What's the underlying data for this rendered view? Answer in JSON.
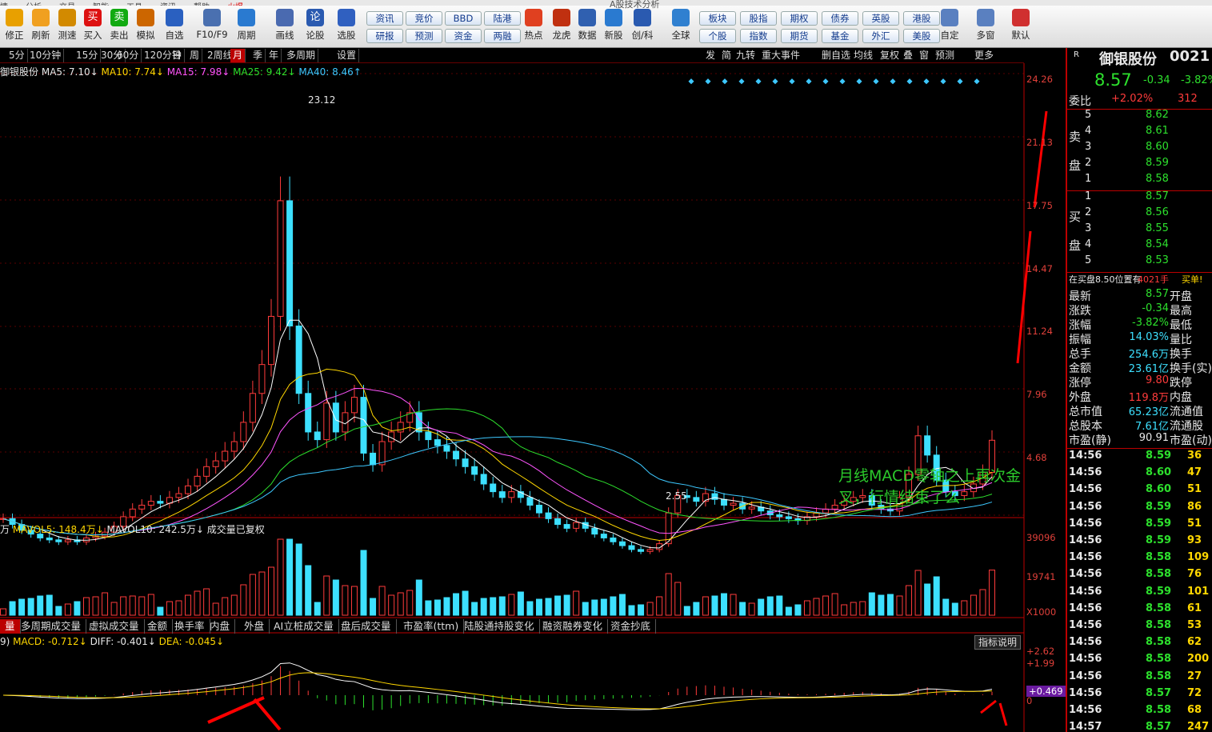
{
  "menu": [
    "情",
    "分析",
    "交易",
    "智能",
    "工具",
    "资讯",
    "帮助",
    "火爆"
  ],
  "toolbar": {
    "left_buttons": [
      {
        "label": "修正",
        "icon": "arrow-up-icon"
      },
      {
        "label": "刷新",
        "icon": "refresh-icon"
      },
      {
        "label": "测速",
        "icon": "clock-icon"
      },
      {
        "label": "买入",
        "icon": "buy-icon",
        "glyph": "买"
      },
      {
        "label": "卖出",
        "icon": "sell-icon",
        "glyph": "卖"
      },
      {
        "label": "模拟",
        "icon": "gavel-icon"
      },
      {
        "label": "自选",
        "icon": "star-icon"
      },
      {
        "label": "F10/F9",
        "icon": "report-icon"
      },
      {
        "label": "周期",
        "icon": "period-icon"
      },
      {
        "label": "画线",
        "icon": "pencil-icon"
      },
      {
        "label": "论股",
        "icon": "discuss-icon",
        "glyph": "论"
      },
      {
        "label": "选股",
        "icon": "select-icon"
      }
    ],
    "grid_buttons": [
      [
        "资讯",
        "研报"
      ],
      [
        "竞价",
        "预测"
      ],
      [
        "BBD",
        "资金"
      ],
      [
        "陆港",
        "两融"
      ]
    ],
    "mid_buttons": [
      {
        "label": "热点",
        "icon": "hot-icon"
      },
      {
        "label": "龙虎",
        "icon": "tiger-icon"
      },
      {
        "label": "数据",
        "icon": "pe-icon"
      },
      {
        "label": "新股",
        "icon": "ipo-icon"
      },
      {
        "label": "创/科",
        "icon": "chuang-icon"
      },
      {
        "label": "全球",
        "icon": "globe-icon"
      }
    ],
    "grid_buttons2": [
      [
        "板块",
        "个股"
      ],
      [
        "股指",
        "指数"
      ],
      [
        "期权",
        "期货"
      ],
      [
        "债券",
        "基金"
      ],
      [
        "英股",
        "外汇"
      ],
      [
        "港股",
        "美股"
      ]
    ],
    "right_buttons": [
      {
        "label": "自定",
        "icon": "custom-icon"
      },
      {
        "label": "多窗",
        "icon": "multiwindow-icon"
      },
      {
        "label": "默认",
        "icon": "home-icon"
      }
    ],
    "top_center_text": "A股技术分析"
  },
  "period_tabs": [
    "5分",
    "10分钟",
    "15分",
    "30分",
    "60分",
    "120分钟",
    "日",
    "周",
    "2周线",
    "月",
    "季",
    "年",
    "多周期",
    "设置"
  ],
  "active_period": "月",
  "toolbar_right": [
    "发",
    "简",
    "九转",
    "重大事件",
    "删自选",
    "均线",
    "复权",
    "叠",
    "窗",
    "预测",
    "更多"
  ],
  "ma_line": {
    "name": "御银股份",
    "ma5": "MA5: 7.10↓",
    "ma10": "MA10: 7.74↓",
    "ma15": "MA15: 7.98↓",
    "ma25": "MA25: 9.42↓",
    "ma40": "MA40: 8.46↑"
  },
  "annotation": {
    "line1": "月线MACD零轴之上再次金",
    "line2": "叉，行情结束了么"
  },
  "price_high": "23.12",
  "price_low": "2.55",
  "vol_line": {
    "vol": "万",
    "mavol5": "MAVOL5: 148.4万↓",
    "mavol10": "MAVOL10: 242.5万↓",
    "note": "成交量已复权"
  },
  "indicator_tabs": [
    "量",
    "多周期成交量",
    "虚拟成交量",
    "金额",
    "换手率",
    "内盘",
    "外盘",
    "AI立桩成交量",
    "盘后成交量",
    "市盈率(ttm)",
    "陆股通持股变化",
    "融资融券变化",
    "资金抄底"
  ],
  "macd_line": {
    "prefix": "9)",
    "macd": "MACD: -0.712↓",
    "diff": "DIFF: -0.401↓",
    "dea": "DEA: -0.045↓"
  },
  "indicator_help": "指标说明",
  "price_axis": [
    "24.26",
    "21.13",
    "17.75",
    "14.47",
    "11.24",
    "7.96",
    "4.68"
  ],
  "vol_axis": [
    "39096",
    "19741",
    "X1000"
  ],
  "macd_axis": [
    "+2.62",
    "+1.99",
    "+0.469",
    "0"
  ],
  "right_panel": {
    "code": "R",
    "name": "御银股份",
    "code_num": "0021",
    "price": "8.57",
    "change": "-0.34",
    "change_pct": "-3.82%",
    "weibi_label": "委比",
    "weibi": "+2.02%",
    "weibi_val": "312",
    "sell": [
      [
        "5",
        "8.62"
      ],
      [
        "4",
        "8.61"
      ],
      [
        "3",
        "8.60"
      ],
      [
        "2",
        "8.59"
      ],
      [
        "1",
        "8.58"
      ]
    ],
    "sell_label": [
      "卖",
      "盘"
    ],
    "buy": [
      [
        "1",
        "8.57"
      ],
      [
        "2",
        "8.56"
      ],
      [
        "3",
        "8.55"
      ],
      [
        "4",
        "8.54"
      ],
      [
        "5",
        "8.53"
      ]
    ],
    "buy_label": [
      "买",
      "盘"
    ],
    "notice": "在买盘8.50位置有",
    "notice_num": "4021手",
    "notice_tail": "买单!",
    "stats": [
      [
        "最新",
        "8.57",
        "开盘"
      ],
      [
        "涨跌",
        "-0.34",
        "最高"
      ],
      [
        "涨幅",
        "-3.82%",
        "最低"
      ],
      [
        "振幅",
        "14.03%",
        "量比"
      ],
      [
        "总手",
        "254.6万",
        "换手"
      ],
      [
        "金额",
        "23.61亿",
        "换手(实)"
      ],
      [
        "涨停",
        "9.80",
        "跌停"
      ],
      [
        "外盘",
        "119.8万",
        "内盘"
      ],
      [
        "总市值",
        "65.23亿",
        "流通值"
      ],
      [
        "总股本",
        "7.61亿",
        "流通股"
      ],
      [
        "市盈(静)",
        "90.91",
        "市盈(动)"
      ]
    ],
    "ticks": [
      [
        "14:56",
        "8.59",
        "36"
      ],
      [
        "14:56",
        "8.60",
        "47"
      ],
      [
        "14:56",
        "8.60",
        "51"
      ],
      [
        "14:56",
        "8.59",
        "86"
      ],
      [
        "14:56",
        "8.59",
        "51"
      ],
      [
        "14:56",
        "8.59",
        "93"
      ],
      [
        "14:56",
        "8.58",
        "109"
      ],
      [
        "14:56",
        "8.58",
        "76"
      ],
      [
        "14:56",
        "8.59",
        "101"
      ],
      [
        "14:56",
        "8.58",
        "61"
      ],
      [
        "14:56",
        "8.58",
        "53"
      ],
      [
        "14:56",
        "8.58",
        "62"
      ],
      [
        "14:56",
        "8.58",
        "200"
      ],
      [
        "14:56",
        "8.58",
        "27"
      ],
      [
        "14:56",
        "8.57",
        "72"
      ],
      [
        "14:56",
        "8.58",
        "68"
      ],
      [
        "14:57",
        "8.57",
        "247"
      ]
    ]
  },
  "colors": {
    "up": "#ff3b3b",
    "down": "#3de0ff",
    "ma5": "#ffffff",
    "ma10": "#ffd700",
    "ma15": "#ff55ff",
    "ma25": "#2de02d",
    "ma40": "#3dc8ff"
  }
}
